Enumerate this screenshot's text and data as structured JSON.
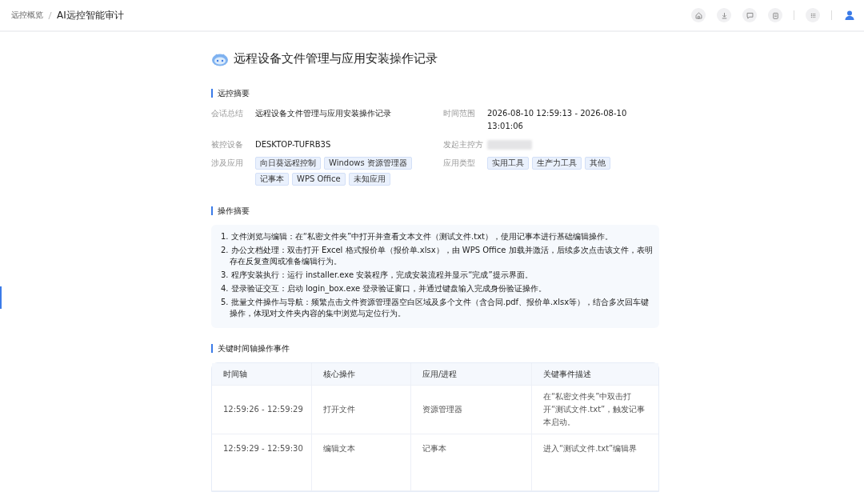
{
  "breadcrumb": [
    {
      "label": "远控概览",
      "current": false
    },
    {
      "label": "AI远控智能审计",
      "current": true
    }
  ],
  "toolbar_icons": [
    {
      "kind": "home"
    },
    {
      "kind": "download"
    },
    {
      "kind": "message"
    },
    {
      "kind": "clipboard"
    },
    {
      "kind": "divider"
    },
    {
      "kind": "apps"
    },
    {
      "kind": "divider"
    },
    {
      "kind": "user"
    }
  ],
  "report": {
    "title": "远程设备文件管理与应用安装操作记录",
    "summary": {
      "heading": "远控摘要",
      "fields": [
        {
          "label": "会话总结",
          "kind": "text",
          "value": "远程设备文件管理与应用安装操作记录"
        },
        {
          "label": "时间范围",
          "kind": "text",
          "value": "2026-08-10 12:59:13 - 2026-08-10 13:01:06"
        },
        {
          "label": "被控设备",
          "kind": "text",
          "value": "DESKTOP-TUFRB3S"
        },
        {
          "label": "发起主控方",
          "kind": "blurred"
        },
        {
          "label": "涉及应用",
          "kind": "tags",
          "tags": [
            "向日葵远程控制",
            "Windows 资源管理器",
            "记事本",
            "WPS Office",
            "未知应用"
          ]
        },
        {
          "label": "应用类型",
          "kind": "tags",
          "tags": [
            "实用工具",
            "生产力工具",
            "其他"
          ]
        }
      ]
    },
    "operations": {
      "heading": "操作摘要",
      "items": [
        "1. 文件浏览与编辑：在“私密文件夹”中打开并查看文本文件（测试文件.txt），使用记事本进行基础编辑操作。",
        "2. 办公文档处理：双击打开 Excel 格式报价单（报价单.xlsx），由 WPS Office 加载并激活，后续多次点击该文件，表明存在反复查阅或准备编辑行为。",
        "3. 程序安装执行：运行 installer.exe 安装程序，完成安装流程并显示“完成”提示界面。",
        "4. 登录验证交互：启动 login_box.exe 登录验证窗口，并通过键盘输入完成身份验证操作。",
        "5. 批量文件操作与导航：频繁点击文件资源管理器空白区域及多个文件（含合同.pdf、报价单.xlsx等），结合多次回车键操作，体现对文件夹内容的集中浏览与定位行为。"
      ]
    },
    "timeline": {
      "heading": "关键时间轴操作事件",
      "columns": [
        "时间轴",
        "核心操作",
        "应用/进程",
        "关键事件描述"
      ],
      "rows": [
        [
          "12:59:26 - 12:59:29",
          "打开文件",
          "资源管理器",
          "在“私密文件夹”中双击打开“测试文件.txt”，触发记事本启动。"
        ],
        [
          "12:59:29 - 12:59:30",
          "编辑文本",
          "记事本",
          "进入“测试文件.txt”编辑界"
        ]
      ]
    }
  }
}
